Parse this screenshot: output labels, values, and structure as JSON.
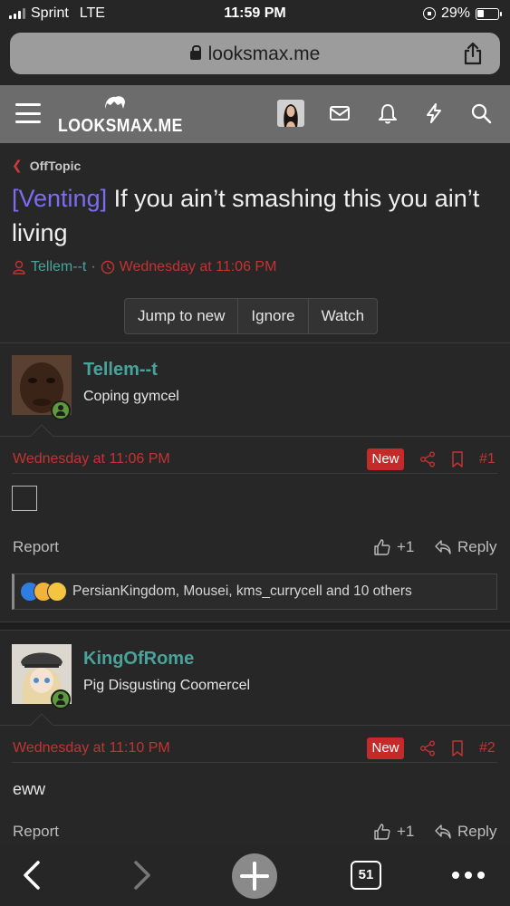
{
  "status": {
    "carrier": "Sprint",
    "network": "LTE",
    "time": "11:59 PM",
    "battery": "29%"
  },
  "browser": {
    "url": "looksmax.me",
    "tabs_count": "51"
  },
  "site": {
    "logo": "LOOKSMAX.ME"
  },
  "thread": {
    "breadcrumb": "OffTopic",
    "prefix": "[Venting]",
    "title": " If you ain’t smashing this you ain’t living",
    "author": "Tellem--t",
    "date": "Wednesday at 11:06 PM",
    "buttons": {
      "jump": "Jump to new",
      "ignore": "Ignore",
      "watch": "Watch"
    }
  },
  "posts": [
    {
      "username": "Tellem--t",
      "user_title": "Coping gymcel",
      "date": "Wednesday at 11:06 PM",
      "badge": "New",
      "number": "#1",
      "report": "Report",
      "like": "+1",
      "reply": "Reply",
      "reactions": "PersianKingdom, Mousei, kms_currycell and 10 others"
    },
    {
      "username": "KingOfRome",
      "user_title": "Pig Disgusting Coomercel",
      "date": "Wednesday at 11:10 PM",
      "badge": "New",
      "number": "#2",
      "body": "eww",
      "report": "Report",
      "like": "+1",
      "reply": "Reply"
    }
  ]
}
